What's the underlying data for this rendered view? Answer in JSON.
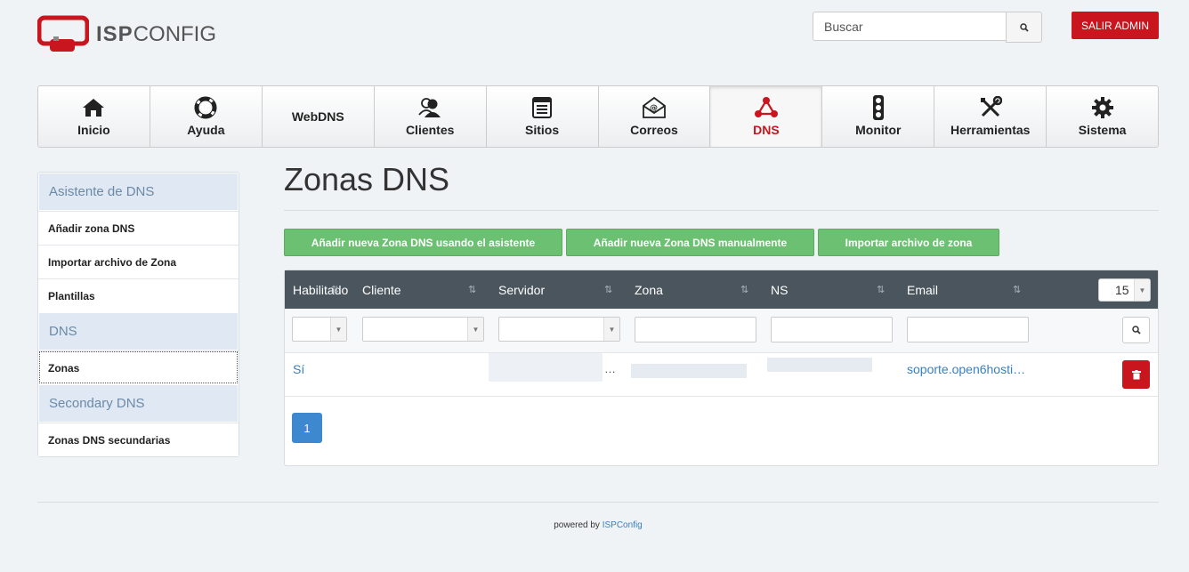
{
  "brand": {
    "bold": "ISP",
    "light": "CONFIG"
  },
  "search": {
    "placeholder": "Buscar"
  },
  "header": {
    "logout_label": "SALIR ADMIN"
  },
  "nav": [
    {
      "label": "Inicio",
      "icon": "home-icon"
    },
    {
      "label": "Ayuda",
      "icon": "lifebuoy-icon"
    },
    {
      "label": "WebDNS",
      "icon": ""
    },
    {
      "label": "Clientes",
      "icon": "users-icon"
    },
    {
      "label": "Sitios",
      "icon": "browser-icon"
    },
    {
      "label": "Correos",
      "icon": "mail-icon"
    },
    {
      "label": "DNS",
      "icon": "network-icon",
      "active": true
    },
    {
      "label": "Monitor",
      "icon": "traffic-light-icon"
    },
    {
      "label": "Herramientas",
      "icon": "tools-icon"
    },
    {
      "label": "Sistema",
      "icon": "gear-icon"
    }
  ],
  "sidebar": {
    "sections": [
      {
        "title": "Asistente de DNS",
        "items": [
          "Añadir zona DNS",
          "Importar archivo de Zona",
          "Plantillas"
        ]
      },
      {
        "title": "DNS",
        "items": [
          "Zonas"
        ]
      },
      {
        "title": "Secondary DNS",
        "items": [
          "Zonas DNS secundarias"
        ]
      }
    ]
  },
  "main": {
    "title": "Zonas DNS",
    "buttons": {
      "wizard": "Añadir nueva Zona DNS usando el asistente",
      "manual": "Añadir nueva Zona DNS manualmente",
      "import": "Importar archivo de zona"
    },
    "table": {
      "columns": [
        "Habilitado",
        "Cliente",
        "Servidor",
        "Zona",
        "NS",
        "Email"
      ],
      "per_page": "15",
      "rows": [
        {
          "habilitado": "Sí",
          "servidor": "…",
          "email": "soporte.open6hosti…"
        }
      ]
    },
    "pagination": {
      "current": "1"
    }
  },
  "footer": {
    "prefix": "powered by",
    "link": "ISPConfig"
  },
  "colors": {
    "brand_red": "#c9151d",
    "green": "#6cc072",
    "header_dark": "#4b555e",
    "link": "#3a7fc1"
  }
}
